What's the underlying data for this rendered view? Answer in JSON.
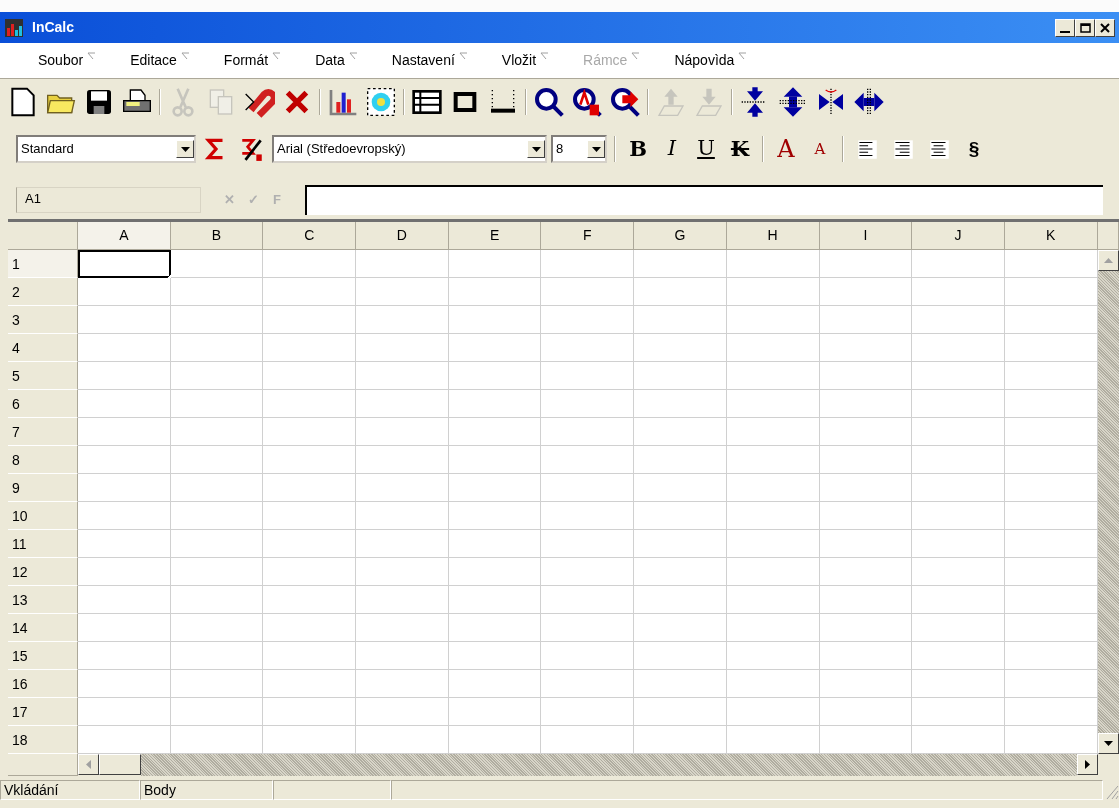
{
  "window": {
    "title": "InCalc"
  },
  "menu": [
    {
      "label": "Soubor",
      "disabled": false
    },
    {
      "label": "Editace",
      "disabled": false
    },
    {
      "label": "Formát",
      "disabled": false
    },
    {
      "label": "Data",
      "disabled": false
    },
    {
      "label": "Nastavení",
      "disabled": false
    },
    {
      "label": "Vložit",
      "disabled": false
    },
    {
      "label": "Rámce",
      "disabled": true
    },
    {
      "label": "Nápovìda",
      "disabled": false
    }
  ],
  "toolbar": [
    {
      "kind": "new",
      "disabled": false
    },
    {
      "kind": "open",
      "disabled": false
    },
    {
      "kind": "save",
      "disabled": false
    },
    {
      "kind": "print",
      "disabled": false
    },
    {
      "kind": "separator"
    },
    {
      "kind": "cut",
      "disabled": true
    },
    {
      "kind": "copy",
      "disabled": true
    },
    {
      "kind": "paste",
      "disabled": false
    },
    {
      "kind": "delete",
      "disabled": false
    },
    {
      "kind": "separator"
    },
    {
      "kind": "chart",
      "disabled": false
    },
    {
      "kind": "picture",
      "disabled": false
    },
    {
      "kind": "separator"
    },
    {
      "kind": "table",
      "disabled": false
    },
    {
      "kind": "frame",
      "disabled": false
    },
    {
      "kind": "line",
      "disabled": false
    },
    {
      "kind": "separator"
    },
    {
      "kind": "zoom",
      "disabled": false
    },
    {
      "kind": "zoom-ab",
      "disabled": false
    },
    {
      "kind": "zoom-go",
      "disabled": false
    },
    {
      "kind": "separator"
    },
    {
      "kind": "layer-up",
      "disabled": true
    },
    {
      "kind": "layer-down",
      "disabled": true
    },
    {
      "kind": "separator"
    },
    {
      "kind": "shrink-v",
      "disabled": false
    },
    {
      "kind": "grow-v",
      "disabled": false
    },
    {
      "kind": "shrink-h",
      "disabled": false
    },
    {
      "kind": "grow-h",
      "disabled": false
    }
  ],
  "format_bar": {
    "style": "Standard",
    "font": "Arial (Středoevropský)",
    "size": "8",
    "buttons": [
      {
        "kind": "sum"
      },
      {
        "kind": "sum-percent"
      },
      {
        "kind": "separator"
      },
      {
        "kind": "bold",
        "label": "B"
      },
      {
        "kind": "italic",
        "label": "I"
      },
      {
        "kind": "underline",
        "label": "U"
      },
      {
        "kind": "strike",
        "label": "K"
      },
      {
        "kind": "separator"
      },
      {
        "kind": "grow",
        "label": "A"
      },
      {
        "kind": "shrink",
        "label": "A"
      },
      {
        "kind": "separator"
      },
      {
        "kind": "align-left"
      },
      {
        "kind": "align-right"
      },
      {
        "kind": "align-center"
      },
      {
        "kind": "section",
        "label": "§"
      }
    ]
  },
  "formula_bar": {
    "cell_ref": "A1",
    "buttons": [
      {
        "label": "✕",
        "disabled": true
      },
      {
        "label": "✓",
        "disabled": true
      },
      {
        "label": "F",
        "disabled": true
      }
    ]
  },
  "sheet": {
    "columns": [
      {
        "label": "A",
        "selected": true
      },
      {
        "label": "B",
        "selected": false
      },
      {
        "label": "C",
        "selected": false
      },
      {
        "label": "D",
        "selected": false
      },
      {
        "label": "E",
        "selected": false
      },
      {
        "label": "F",
        "selected": false
      },
      {
        "label": "G",
        "selected": false
      },
      {
        "label": "H",
        "selected": false
      },
      {
        "label": "I",
        "selected": false
      },
      {
        "label": "J",
        "selected": false
      },
      {
        "label": "K",
        "selected": false
      }
    ],
    "rows": [
      {
        "label": "1",
        "selected": true
      },
      {
        "label": "2",
        "selected": false
      },
      {
        "label": "3",
        "selected": false
      },
      {
        "label": "4",
        "selected": false
      },
      {
        "label": "5",
        "selected": false
      },
      {
        "label": "6",
        "selected": false
      },
      {
        "label": "7",
        "selected": false
      },
      {
        "label": "8",
        "selected": false
      },
      {
        "label": "9",
        "selected": false
      },
      {
        "label": "10",
        "selected": false
      },
      {
        "label": "11",
        "selected": false
      },
      {
        "label": "12",
        "selected": false
      },
      {
        "label": "13",
        "selected": false
      },
      {
        "label": "14",
        "selected": false
      },
      {
        "label": "15",
        "selected": false
      },
      {
        "label": "16",
        "selected": false
      },
      {
        "label": "17",
        "selected": false
      },
      {
        "label": "18",
        "selected": false
      }
    ]
  },
  "status_bar": [
    "Vkládání",
    "Body"
  ]
}
